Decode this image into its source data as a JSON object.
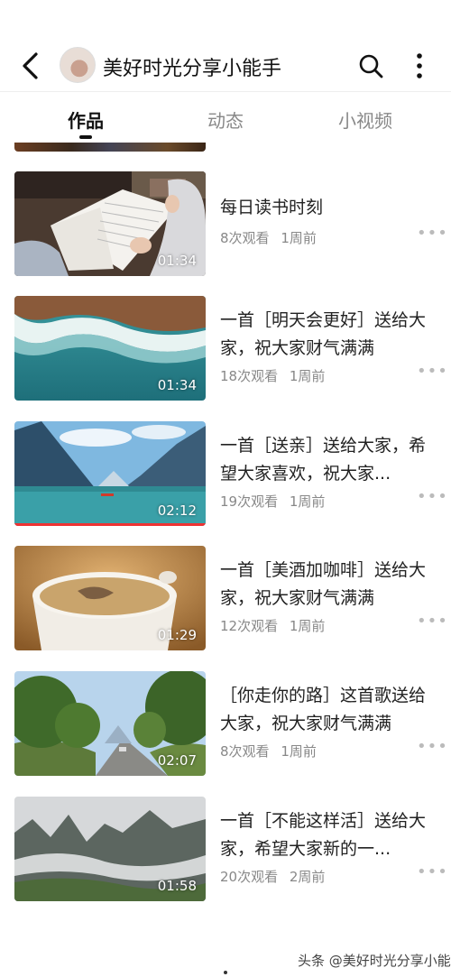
{
  "header": {
    "title": "美好时光分享小能手"
  },
  "tabs": [
    {
      "label": "作品",
      "active": true
    },
    {
      "label": "动态",
      "active": false
    },
    {
      "label": "小视频",
      "active": false
    }
  ],
  "videos": [
    {
      "title": "每日读书时刻",
      "views": "8次观看",
      "time": "1周前",
      "duration": "01:34"
    },
    {
      "title": "一首［明天会更好］送给大家，祝大家财气满满",
      "views": "18次观看",
      "time": "1周前",
      "duration": "01:34"
    },
    {
      "title": "一首［送亲］送给大家，希望大家喜欢，祝大家...",
      "views": "19次观看",
      "time": "1周前",
      "duration": "02:12"
    },
    {
      "title": "一首［美酒加咖啡］送给大家，祝大家财气满满",
      "views": "12次观看",
      "time": "1周前",
      "duration": "01:29"
    },
    {
      "title": "［你走你的路］这首歌送给大家，祝大家财气满满",
      "views": "8次观看",
      "time": "1周前",
      "duration": "02:07"
    },
    {
      "title": "一首［不能这样活］送给大家，希望大家新的一...",
      "views": "20次观看",
      "time": "2周前",
      "duration": "01:58"
    }
  ],
  "watermark": "头条 @美好时光分享小能手",
  "icons": [
    "back-arrow-icon",
    "avatar",
    "search-icon",
    "more-vertical-icon",
    "more-horizontal-icon"
  ],
  "colors": {
    "text": "#222222",
    "muted": "#888888",
    "progress": "#e33333"
  }
}
